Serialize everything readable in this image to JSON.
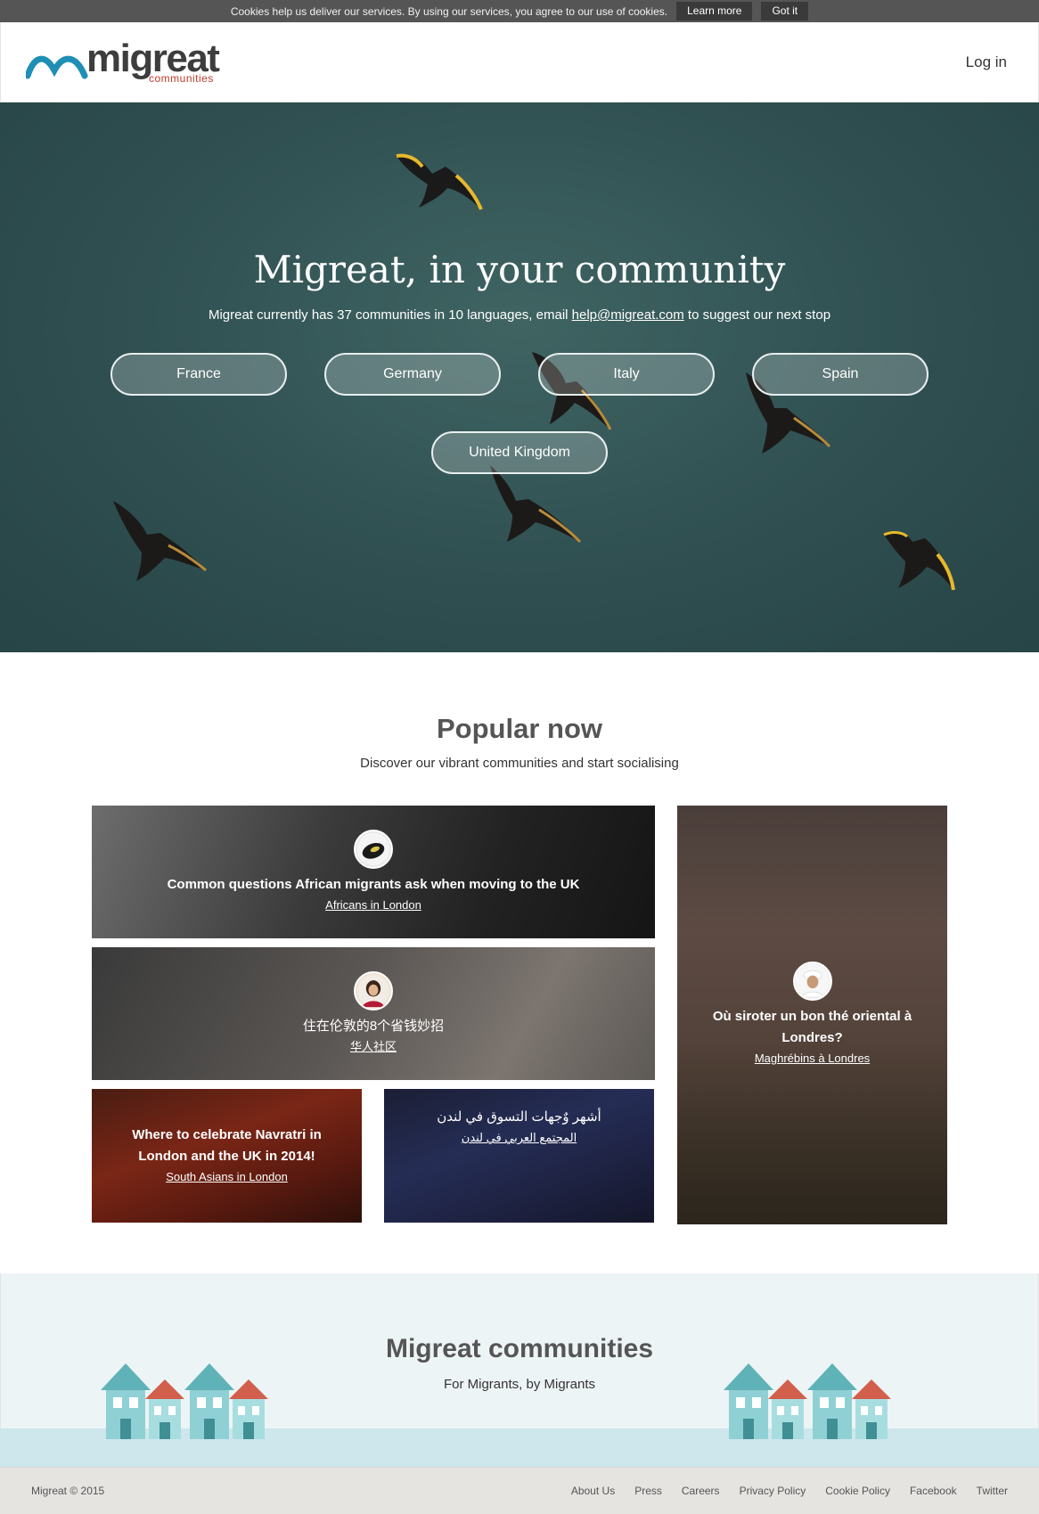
{
  "cookie": {
    "message": "Cookies help us deliver our services. By using our services, you agree to our use of cookies.",
    "learn_more": "Learn more",
    "got_it": "Got it"
  },
  "header": {
    "logo_word": "migreat",
    "logo_sub": "communities",
    "login": "Log in"
  },
  "hero": {
    "title": "Migreat, in your community",
    "subtitle_pre": "Migreat currently has 37 communities in 10 languages, email ",
    "email": "help@migreat.com",
    "subtitle_post": " to suggest our next stop",
    "countries": [
      "France",
      "Germany",
      "Italy",
      "Spain",
      "United Kingdom"
    ]
  },
  "popular": {
    "title": "Popular now",
    "subtitle": "Discover our vibrant communities and start socialising",
    "cards": [
      {
        "title": "Common questions African migrants ask when moving to the UK",
        "link": "Africans in London"
      },
      {
        "title": "住在伦敦的8个省钱妙招",
        "link": "华人社区"
      },
      {
        "title": "Where to celebrate Navratri in London and the UK in 2014!",
        "link": "South Asians in London"
      },
      {
        "title": "أشهر وٌجهات التسوق في لندن",
        "link": "المجتمع العربي في لندن"
      },
      {
        "title": "Où siroter un bon thé oriental à Londres?",
        "link": "Maghrébins à Londres"
      }
    ]
  },
  "communities": {
    "title": "Migreat communities",
    "subtitle": "For Migrants, by Migrants"
  },
  "footer": {
    "copyright": "Migreat © 2015",
    "links": [
      "About Us",
      "Press",
      "Careers",
      "Privacy Policy",
      "Cookie Policy",
      "Facebook",
      "Twitter"
    ]
  },
  "colors": {
    "hero_bg": "#2f4f51",
    "cookie_bg": "#555555",
    "logo_accent": "#c0392b",
    "logo_wave": "#1f8fb5"
  }
}
